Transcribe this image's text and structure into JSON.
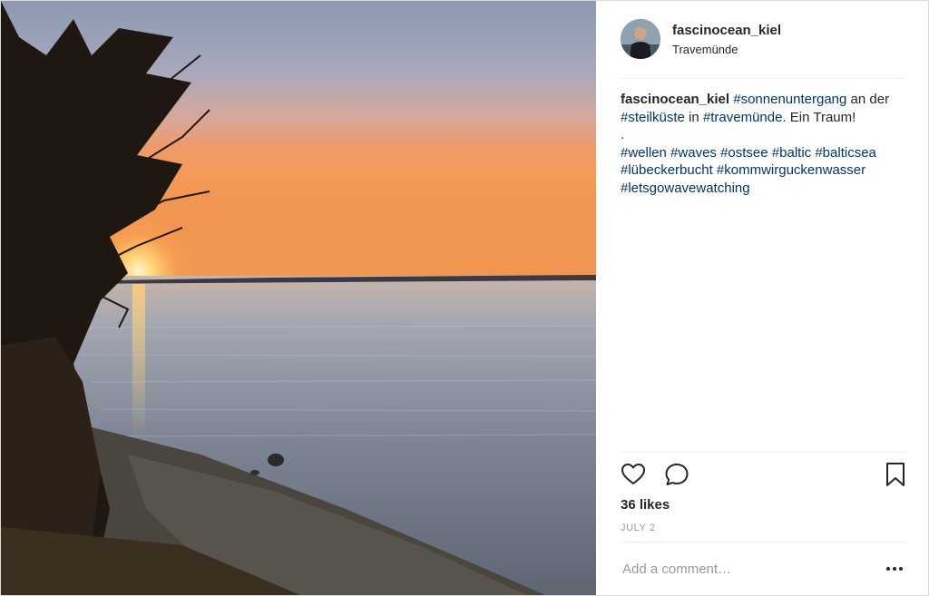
{
  "post": {
    "username": "fascinocean_kiel",
    "location": "Travemünde",
    "caption": {
      "username": "fascinocean_kiel",
      "tags": {
        "sonnenuntergang": "#sonnenuntergang",
        "steilkueste": "#steilküste",
        "travemuende": "#travemünde",
        "wellen": "#wellen",
        "waves": "#waves",
        "ostsee": "#ostsee",
        "baltic": "#baltic",
        "balticsea": "#balticsea",
        "luebeckerbucht": "#lübeckerbucht",
        "kommwirguckenwasser": "#kommwirguckenwasser",
        "letsgowavewatching": "#letsgowavewatching"
      },
      "text_an": " an der ",
      "text_in": " in ",
      "text_end": ". Ein Traum!",
      "dot": "."
    },
    "likes": "36 likes",
    "date": "JULY 2",
    "comment_placeholder": "Add a comment…"
  },
  "icons": {
    "like": "heart-icon",
    "comment": "comment-icon",
    "save": "bookmark-icon",
    "more": "more-options-icon"
  },
  "colors": {
    "hashtag": "#003569",
    "text": "#262626",
    "muted": "#999999",
    "border": "#dbdbdb"
  }
}
